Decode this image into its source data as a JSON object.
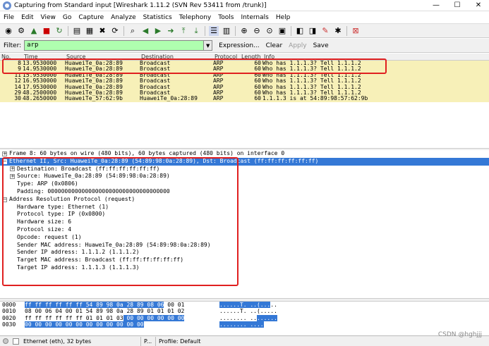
{
  "window": {
    "title": "Capturing from Standard input   [Wireshark 1.11.2  (SVN Rev 53411 from /trunk)]",
    "minimize": "—",
    "maximize": "☐",
    "close": "✕"
  },
  "menu": [
    "File",
    "Edit",
    "View",
    "Go",
    "Capture",
    "Analyze",
    "Statistics",
    "Telephony",
    "Tools",
    "Internals",
    "Help"
  ],
  "toolbar": {
    "icons": [
      "interface-list-icon",
      "options-icon",
      "start-icon",
      "stop-icon",
      "restart-icon",
      "open-icon",
      "save-icon",
      "close-file-icon",
      "reload-icon",
      "find-icon",
      "back-icon",
      "forward-icon",
      "go-to-icon",
      "first-icon",
      "last-icon",
      "colorize-icon",
      "auto-scroll-icon",
      "zoom-in-icon",
      "zoom-out-icon",
      "normal-size-icon",
      "resize-columns-icon",
      "capture-filters-icon",
      "display-filters-icon",
      "coloring-rules-icon",
      "preferences-icon",
      "help-icon"
    ],
    "accent": "#2a7a2a"
  },
  "filter": {
    "label": "Filter:",
    "value": "arp",
    "expression": "Expression...",
    "clear": "Clear",
    "apply": "Apply",
    "save": "Save",
    "bg": "#afffaf"
  },
  "packet_list": {
    "headers": [
      "No.",
      "Time",
      "Source",
      "Destination",
      "Protocol",
      "Length",
      "Info"
    ],
    "rows": [
      {
        "no": "8",
        "time": "13.9530000",
        "src": "HuaweiTe_0a:28:89",
        "dst": "Broadcast",
        "proto": "ARP",
        "len": "60",
        "info": "Who has 1.1.1.3?  Tell 1.1.1.2"
      },
      {
        "no": "9",
        "time": "14.9530000",
        "src": "HuaweiTe_0a:28:89",
        "dst": "Broadcast",
        "proto": "ARP",
        "len": "60",
        "info": "Who has 1.1.1.3?  Tell 1.1.1.2"
      },
      {
        "no": "11",
        "time": "15.9530000",
        "src": "HuaweiTe_0a:28:89",
        "dst": "Broadcast",
        "proto": "ARP",
        "len": "60",
        "info": "Who has 1.1.1.3?  Tell 1.1.1.2"
      },
      {
        "no": "12",
        "time": "16.9530000",
        "src": "HuaweiTe_0a:28:89",
        "dst": "Broadcast",
        "proto": "ARP",
        "len": "60",
        "info": "Who has 1.1.1.3?  Tell 1.1.1.2"
      },
      {
        "no": "14",
        "time": "17.9530000",
        "src": "HuaweiTe_0a:28:89",
        "dst": "Broadcast",
        "proto": "ARP",
        "len": "60",
        "info": "Who has 1.1.1.3?  Tell 1.1.1.2"
      },
      {
        "no": "29",
        "time": "48.2500000",
        "src": "HuaweiTe_0a:28:89",
        "dst": "Broadcast",
        "proto": "ARP",
        "len": "60",
        "info": "Who has 1.1.1.3?  Tell 1.1.1.2"
      },
      {
        "no": "30",
        "time": "48.2650000",
        "src": "HuaweiTe_57:62:9b",
        "dst": "HuaweiTe_0a:28:89",
        "proto": "ARP",
        "len": "60",
        "info": "1.1.1.3 is at 54:89:98:57:62:9b"
      }
    ],
    "row_color": "#f7f0b8"
  },
  "details": {
    "frame": "Frame 8: 60 bytes on wire (480 bits), 60 bytes captured (480 bits) on interface 0",
    "eth": "Ethernet II, Src: HuaweiTe_0a:28:89 (54:89:98:0a:28:89), Dst: Broadcast (ff:ff:ff:ff:ff:ff)",
    "eth_dst": "Destination: Broadcast (ff:ff:ff:ff:ff:ff)",
    "eth_src": "Source: HuaweiTe_0a:28:89 (54:89:98:0a:28:89)",
    "eth_type": "Type: ARP (0x0806)",
    "eth_pad": "Padding: 000000000000000000000000000000000000",
    "arp": "Address Resolution Protocol (request)",
    "arp_fields": [
      "Hardware type: Ethernet (1)",
      "Protocol type: IP (0x0800)",
      "Hardware size: 6",
      "Protocol size: 4",
      "Opcode: request (1)",
      "Sender MAC address: HuaweiTe_0a:28:89 (54:89:98:0a:28:89)",
      "Sender IP address: 1.1.1.2 (1.1.1.2)",
      "Target MAC address: Broadcast (ff:ff:ff:ff:ff:ff)",
      "Target IP address: 1.1.1.3 (1.1.1.3)"
    ],
    "select_color": "#3478d6"
  },
  "hex": {
    "rows": [
      {
        "off": "0000",
        "hl": "ff ff ff ff ff ff 54 89  98 0a 28 89 08 06",
        "rest": " 00 01",
        "ascii_hl": "......T. ..(...",
        "ascii_rest": ".."
      },
      {
        "off": "0010",
        "hl": "",
        "rest": "08 00 06 04 00 01 54 89  98 0a 28 89 01 01 01 02",
        "ascii_hl": "",
        "ascii_rest": "......T. ..(....."
      },
      {
        "off": "0020",
        "hl_pre": "ff ff ff ff ff ff 01 01  01 03",
        "hl": " 00 00 00 00 00 00",
        "ascii_pre": "........ ..",
        "ascii_hl": "......"
      },
      {
        "off": "0030",
        "hl": "00 00 00 00 00 00 00 00  00 00 00 00",
        "ascii_hl": "........ ...."
      }
    ]
  },
  "status": {
    "field": "Ethernet (eth), 32 bytes",
    "packets": "P...",
    "profile": "Profile: Default"
  },
  "watermark": "CSDN @hghjjj",
  "annotation_color": "#e02020"
}
